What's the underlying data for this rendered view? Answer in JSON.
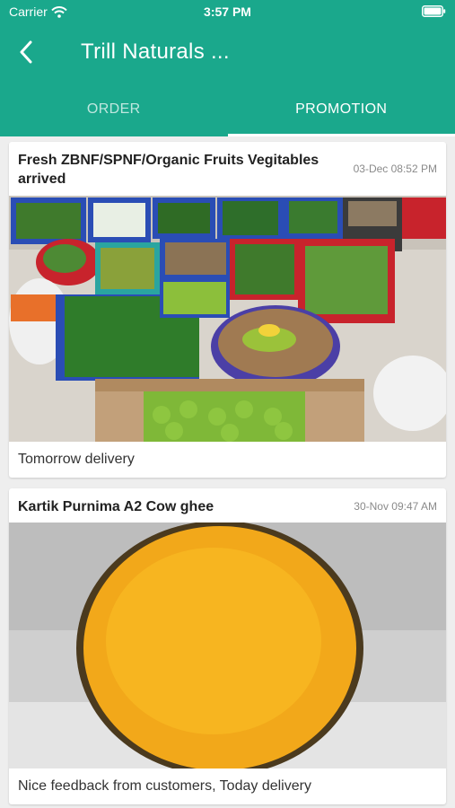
{
  "status_bar": {
    "carrier": "Carrier",
    "time": "3:57 PM"
  },
  "navbar": {
    "title": "Trill Naturals ..."
  },
  "tabs": [
    {
      "label": "ORDER"
    },
    {
      "label": "PROMOTION"
    }
  ],
  "posts": [
    {
      "title": "Fresh ZBNF/SPNF/Organic Fruits Vegitables arrived",
      "date": "03-Dec 08:52 PM",
      "caption": "Tomorrow delivery"
    },
    {
      "title": "Kartik Purnima A2 Cow ghee",
      "date": "30-Nov 09:47 AM",
      "caption": "Nice feedback from customers, Today delivery"
    }
  ],
  "colors": {
    "header": "#1aa88c",
    "background": "#eeeeee",
    "ghee": "#f5b212"
  }
}
